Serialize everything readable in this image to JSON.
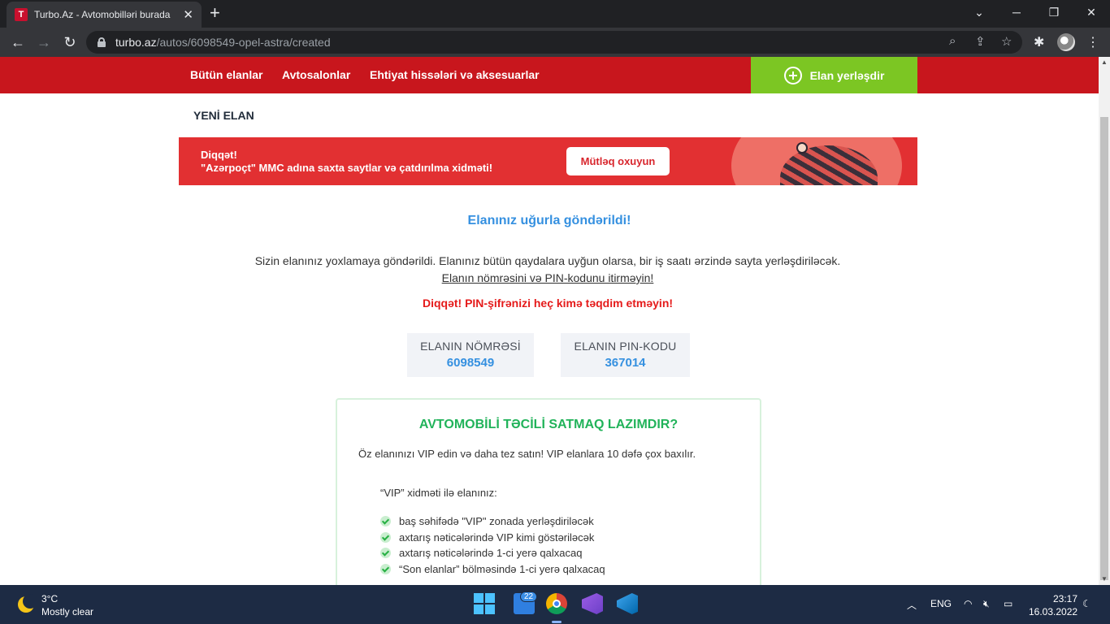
{
  "browser": {
    "tab_title": "Turbo.Az - Avtomobilləri burada",
    "favicon_letter": "T",
    "tab_close": "✕",
    "new_tab": "+",
    "url_host": "turbo.az",
    "url_path": "/autos/6098549-opel-astra/created",
    "minimize": "─",
    "maximize": "❐",
    "close": "✕",
    "dropdown": "⌄"
  },
  "site_nav": {
    "links": [
      "Bütün elanlar",
      "Avtosalonlar",
      "Ehtiyat hissələri və aksesuarlar"
    ],
    "post_button": "Elan yerləşdir"
  },
  "page": {
    "heading": "YENİ ELAN"
  },
  "banner": {
    "line1": "Diqqət!",
    "line2": "\"Azərpoçt\" MMC adına saxta saytlar və çatdırılma xidməti!",
    "button": "Mütləq oxuyun"
  },
  "success": {
    "title": "Elanınız uğurla göndərildi!",
    "info": "Sizin elanınız yoxlamaya göndərildi. Elanınız bütün qaydalara uyğun olarsa, bir iş saatı ərzində sayta yerləşdiriləcək.",
    "link": "Elanın nömrəsini və PIN-kodunu itirməyin!",
    "warning": "Diqqət! PIN-şifrənizi heç kimə təqdim etməyin!"
  },
  "codes": {
    "number_label": "ELANIN NÖMRƏSİ",
    "number_value": "6098549",
    "pin_label": "ELANIN PIN-KODU",
    "pin_value": "367014"
  },
  "vip": {
    "title": "AVTOMOBİLİ TƏCİLİ SATMAQ LAZIMDIR?",
    "description": "Öz elanınızı VIP edin və daha tez satın! VIP elanlara 10 dəfə çox baxılır.",
    "subtitle": "“VIP” xidməti ilə elanınız:",
    "items": [
      "baş səhifədə \"VIP\" zonada yerləşdiriləcək",
      "axtarış nəticələrində VIP kimi göstəriləcək",
      "axtarış nəticələrində 1-ci yerə qalxacaq",
      "“Son elanlar” bölməsində 1-ci yerə qalxacaq"
    ]
  },
  "taskbar": {
    "temperature": "3°C",
    "weather": "Mostly clear",
    "widgets_badge": "22",
    "language": "ENG",
    "time": "23:17",
    "date": "16.03.2022"
  }
}
